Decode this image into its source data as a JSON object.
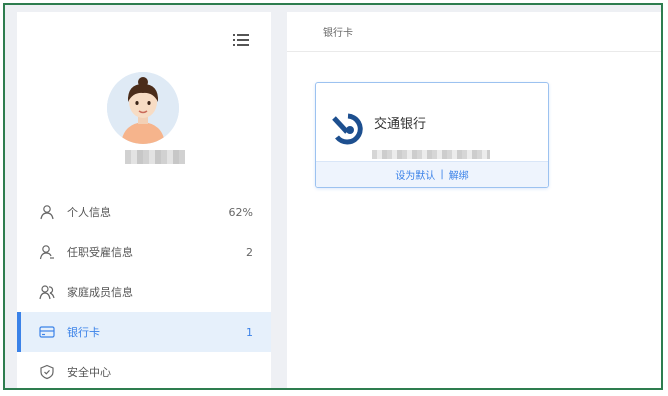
{
  "header": {
    "breadcrumb": "银行卡"
  },
  "sidebar": {
    "items": [
      {
        "label": "个人信息",
        "count": "62%",
        "icon": "user-icon"
      },
      {
        "label": "任职受雇信息",
        "count": "2",
        "icon": "employee-icon"
      },
      {
        "label": "家庭成员信息",
        "count": "",
        "icon": "family-icon"
      },
      {
        "label": "银行卡",
        "count": "1",
        "icon": "card-icon",
        "active": true
      },
      {
        "label": "安全中心",
        "count": "",
        "icon": "shield-icon"
      }
    ]
  },
  "main": {
    "card": {
      "bank_name": "交通银行",
      "set_default": "设为默认",
      "separator": "|",
      "unbind": "解绑"
    }
  },
  "colors": {
    "accent": "#3b82e8",
    "active_bg": "#e6f0fb",
    "frame": "#2e7d4f",
    "logo": "#1d4f8f"
  }
}
